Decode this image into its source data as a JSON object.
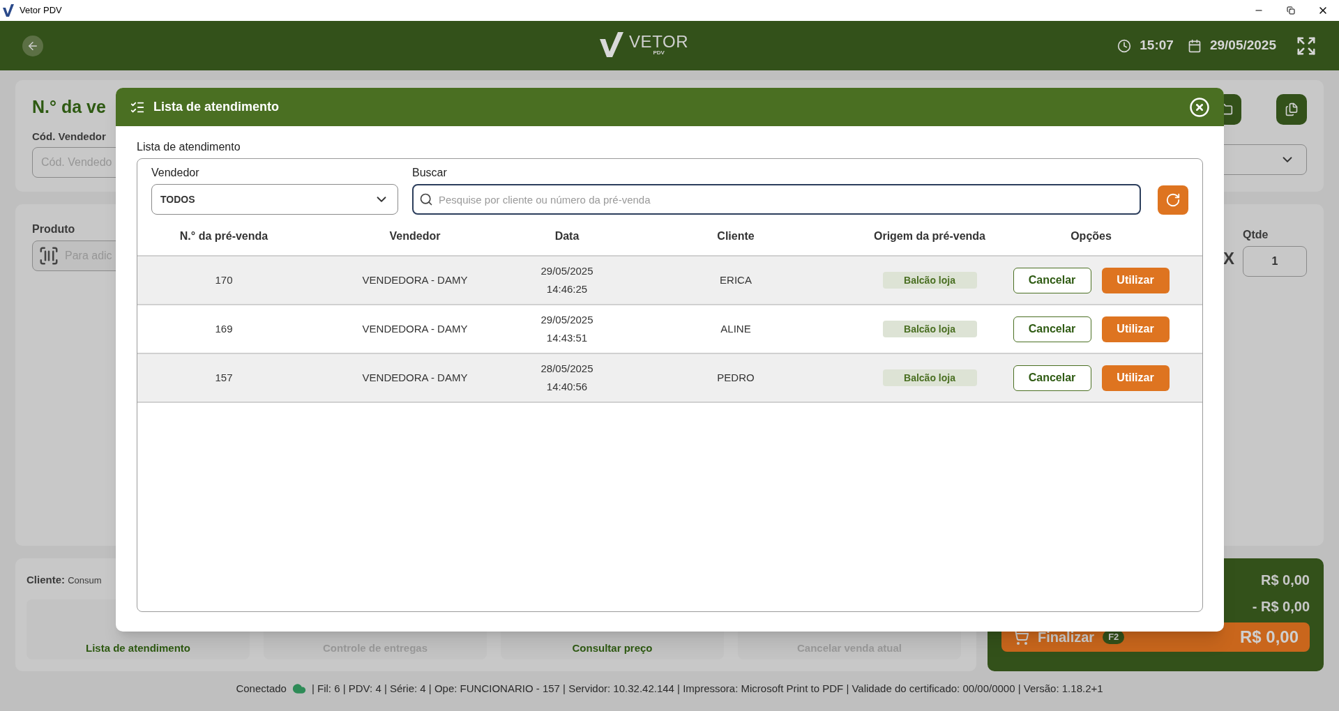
{
  "window": {
    "title": "Vetor PDV"
  },
  "header": {
    "logo": "VETOR",
    "logo_sub": "PDV",
    "time": "15:07",
    "date": "29/05/2025"
  },
  "sale_card": {
    "title": "N.° da ve",
    "seller_code": {
      "label": "Cód. Vendedor",
      "placeholder": "Cód. Vendedo"
    }
  },
  "product_card": {
    "label": "Produto",
    "placeholder": "Para adic",
    "quantity": {
      "label": "Qtde",
      "times": "X",
      "value": "1"
    }
  },
  "client": {
    "label": "Cliente:",
    "value": "Consum"
  },
  "actions": [
    {
      "label": "Lista de atendimento",
      "disabled": false
    },
    {
      "label": "Controle de entregas",
      "disabled": true
    },
    {
      "label": "Consultar preço",
      "disabled": false
    },
    {
      "label": "Cancelar venda atual",
      "disabled": true
    }
  ],
  "totals": {
    "subtotal": "R$ 0,00",
    "discount": "- R$ 0,00",
    "finish": {
      "label": "Finalizar",
      "key": "F2"
    },
    "total": "R$ 0,00"
  },
  "status_bar": {
    "connection": "Conectado",
    "details": "| Fil: 6 | PDV: 4 | Série: 4 | Ope: FUNCIONARIO - 157 | Servidor: 10.32.42.144 | Impressora: Microsoft Print to PDF | Validade do certificado: 00/00/0000 | Versão: 1.18.2+1"
  },
  "modal": {
    "title": "Lista de atendimento",
    "section": "Lista de atendimento",
    "seller_filter": {
      "label": "Vendedor",
      "value": "TODOS"
    },
    "search": {
      "label": "Buscar",
      "placeholder": "Pesquise por cliente ou número da pré-venda"
    },
    "columns": [
      "N.° da pré-venda",
      "Vendedor",
      "Data",
      "Cliente",
      "Origem da pré-venda",
      "Opções"
    ],
    "rows": [
      {
        "number": "170",
        "seller": "VENDEDORA - DAMY",
        "date": "29/05/2025",
        "time": "14:46:25",
        "client": "ERICA",
        "origin": "Balcão loja",
        "actions": [
          "Cancelar",
          "Utilizar"
        ]
      },
      {
        "number": "169",
        "seller": "VENDEDORA - DAMY",
        "date": "29/05/2025",
        "time": "14:43:51",
        "client": "ALINE",
        "origin": "Balcão loja",
        "actions": [
          "Cancelar",
          "Utilizar"
        ]
      },
      {
        "number": "157",
        "seller": "VENDEDORA - DAMY",
        "date": "28/05/2025",
        "time": "14:40:56",
        "client": "PEDRO",
        "origin": "Balcão loja",
        "actions": [
          "Cancelar",
          "Utilizar"
        ]
      }
    ]
  }
}
